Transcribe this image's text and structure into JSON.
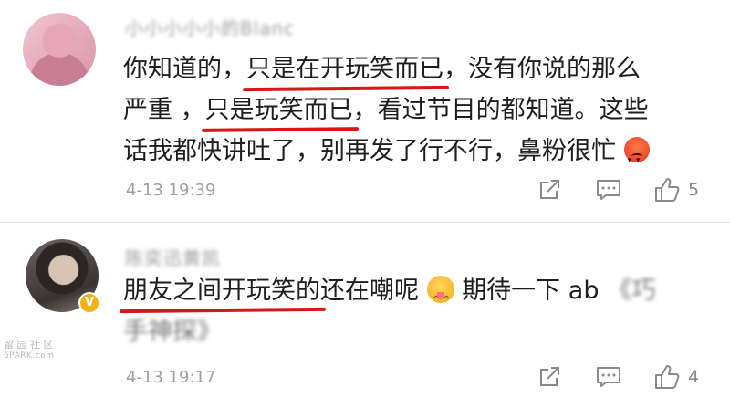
{
  "comments": [
    {
      "username": "小小小小小的Blanc",
      "text_parts": [
        "你知道的，",
        "只是在开玩笑而已",
        "，没有你说的那么"
      ],
      "line2_parts": [
        "严重 ，",
        "只是玩笑而已",
        "，看过节目的都知道。这些"
      ],
      "line3": "话我都快讲吐了，别再发了行不行，鼻粉很忙",
      "emoji": "angry-emoji",
      "time": "4-13 19:39",
      "likes": "5"
    },
    {
      "username": "陈奕迅黄凯",
      "text_parts": [
        "朋友之间开玩笑的",
        "还在嘲呢"
      ],
      "text_tail": "期待一下 ab",
      "text_blur": "《巧",
      "line2_blur": "手神探》",
      "emoji": "yum-emoji",
      "verified": "V",
      "time": "4-13 19:17",
      "likes": "4"
    }
  ],
  "watermark": {
    "line1": "留 园 社 区",
    "line2": "6PARK.com"
  },
  "colors": {
    "underline": "#d81717",
    "text": "#1e1e1e",
    "meta": "#a0a0a0",
    "verified": "#f2b316"
  },
  "icons": [
    "share-icon",
    "comment-icon",
    "like-icon"
  ]
}
